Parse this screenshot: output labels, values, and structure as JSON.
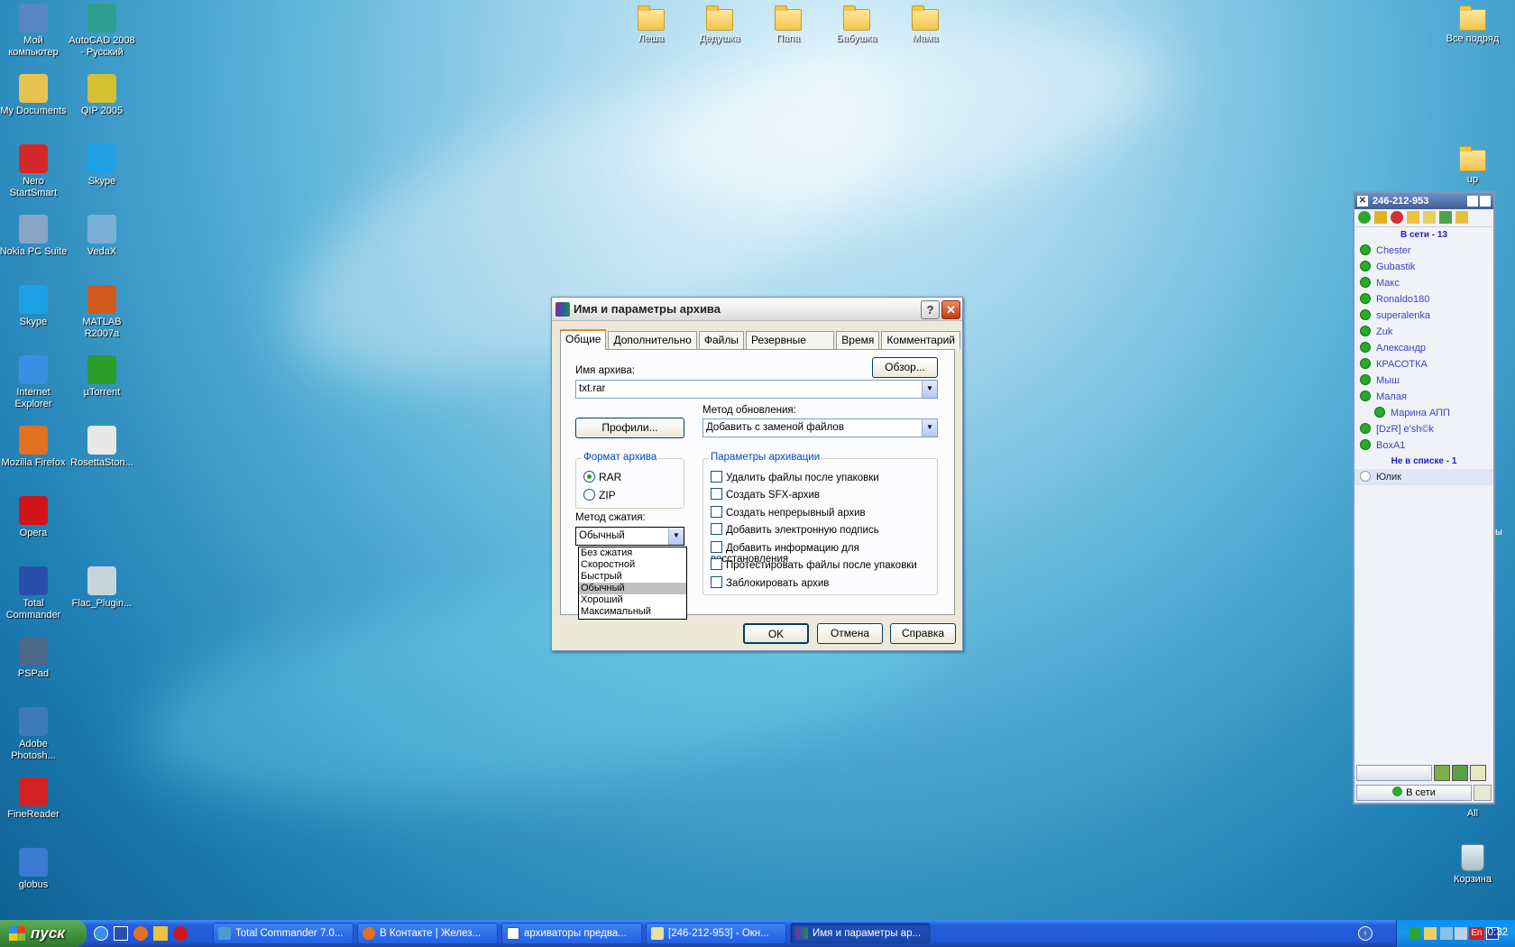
{
  "desktop": {
    "left_icons": [
      {
        "label": "Мой компьютер",
        "icon": "computer-icon",
        "color": "#5a86c8"
      },
      {
        "label": "AutoCAD 2008 - Русский",
        "icon": "autocad-icon",
        "color": "#2f9f8f"
      },
      {
        "label": "My Documents",
        "icon": "documents-folder-icon",
        "color": "#e6c34f"
      },
      {
        "label": "QIP 2005",
        "icon": "qip-icon",
        "color": "#d4c030"
      },
      {
        "label": "Nero StartSmart",
        "icon": "nero-icon",
        "color": "#d22828"
      },
      {
        "label": "Skype",
        "icon": "skype-icon",
        "color": "#1ea0e6"
      },
      {
        "label": "Nokia PC Suite",
        "icon": "nokia-icon",
        "color": "#8aa4c8"
      },
      {
        "label": "VedaX",
        "icon": "vedax-icon",
        "color": "#7ab0d8"
      },
      {
        "label": "Skype",
        "icon": "skype-icon",
        "color": "#1ea0e6"
      },
      {
        "label": "MATLAB R2007a",
        "icon": "matlab-icon",
        "color": "#d35a1e"
      },
      {
        "label": "Internet Explorer",
        "icon": "internet-explorer-icon",
        "color": "#3a8fe0"
      },
      {
        "label": "µTorrent",
        "icon": "utorrent-icon",
        "color": "#2a9d2a"
      },
      {
        "label": "Mozilla Firefox",
        "icon": "firefox-icon",
        "color": "#e2701e"
      },
      {
        "label": "RosettaSton...",
        "icon": "rosetta-icon",
        "color": "#e8e8e8"
      },
      {
        "label": "Opera",
        "icon": "opera-icon",
        "color": "#d3131a"
      },
      {
        "label": "",
        "icon": "",
        "color": ""
      },
      {
        "label": "Total Commander",
        "icon": "total-commander-icon",
        "color": "#2b4fa8"
      },
      {
        "label": "Flac_Plugin...",
        "icon": "flac-plugin-icon",
        "color": "#c8d4dc"
      },
      {
        "label": "PSPad",
        "icon": "pspad-icon",
        "color": "#4b6a8a"
      },
      {
        "label": "",
        "icon": "",
        "color": ""
      },
      {
        "label": "Adobe Photosh...",
        "icon": "photoshop-icon",
        "color": "#3d7ab8"
      },
      {
        "label": "",
        "icon": "",
        "color": ""
      },
      {
        "label": "FineReader",
        "icon": "finereader-icon",
        "color": "#d42020"
      },
      {
        "label": "",
        "icon": "",
        "color": ""
      },
      {
        "label": "globus",
        "icon": "globe-icon",
        "color": "#3a7ad0"
      }
    ],
    "top_folders": [
      "Леша",
      "Дедушка",
      "Папа",
      "Бабушка",
      "Мама"
    ],
    "right_icons": {
      "all_folder": "Все подряд",
      "up_folder": "up",
      "all_label": "All",
      "recycle_bin": "Корзина",
      "edge_text": "ы"
    }
  },
  "dialog": {
    "title": "Имя и параметры архива",
    "help_btn": "?",
    "close_btn": "✕",
    "tabs": [
      "Общие",
      "Дополнительно",
      "Файлы",
      "Резервные копии",
      "Время",
      "Комментарий"
    ],
    "archive_name_label": "Имя архива:",
    "browse_button": "Обзор...",
    "archive_name_value": "txt.rar",
    "profiles_button": "Профили...",
    "update_method_label": "Метод обновления:",
    "update_method_value": "Добавить с заменой файлов",
    "format_group": "Формат архива",
    "format_options": [
      "RAR",
      "ZIP"
    ],
    "compression_label": "Метод сжатия:",
    "compression_value": "Обычный",
    "compression_options": [
      "Без сжатия",
      "Скоростной",
      "Быстрый",
      "Обычный",
      "Хороший",
      "Максимальный"
    ],
    "params_group": "Параметры архивации",
    "params": [
      "Удалить файлы после упаковки",
      "Создать SFX-архив",
      "Создать непрерывный архив",
      "Добавить электронную подпись",
      "Добавить информацию для восстановления",
      "Протестировать файлы после упаковки",
      "Заблокировать архив"
    ],
    "ok_button": "OK",
    "cancel_button": "Отмена",
    "help_button": "Справка"
  },
  "qip": {
    "uin": "246-212-953",
    "online_group": "В сети - 13",
    "contacts": [
      "Chester",
      "Gubastik",
      "Макс",
      "Ronaldo180",
      "superalenka",
      "Zuk",
      "Александр",
      "КРАСОТКА",
      "Мыш",
      "Малая",
      "Марина АПП",
      "[DzR] e'sh©k",
      "BoxA1"
    ],
    "not_in_list_group": "Не в списке - 1",
    "not_in_list": [
      "Юлик"
    ],
    "status_button": "В сети",
    "colors": {
      "online": "#2ca82c",
      "name": "#4040c0",
      "header": "#3d5f99"
    }
  },
  "taskbar": {
    "start": "пуск",
    "tasks": [
      "Total Commander 7.0...",
      "В Контакте | Желез...",
      "архиваторы предва...",
      "[246-212-953] - Окн...",
      "Имя и параметры ар..."
    ],
    "lang": "En",
    "clock": "0:32"
  }
}
